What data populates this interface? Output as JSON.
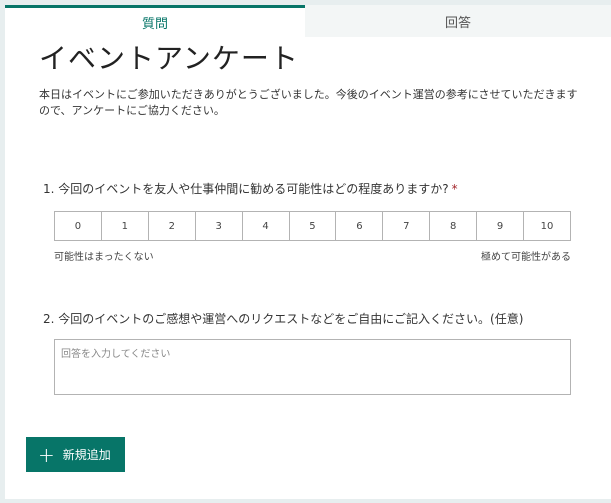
{
  "tabs": {
    "question_label": "質問",
    "answer_label": "回答"
  },
  "form": {
    "title": "イベントアンケート",
    "description": "本日はイベントにご参加いただきありがとうございました。今後のイベント運営の参考にさせていただきますので、アンケートにご協力ください。"
  },
  "question1": {
    "title": "1. 今回のイベントを友人や仕事仲間に勧める可能性はどの程度ありますか?",
    "required_mark": "*",
    "scale": [
      "0",
      "1",
      "2",
      "3",
      "4",
      "5",
      "6",
      "7",
      "8",
      "9",
      "10"
    ],
    "low_label": "可能性はまったくない",
    "high_label": "極めて可能性がある"
  },
  "question2": {
    "title": "2. 今回のイベントのご感想や運営へのリクエストなどをご自由にご記入ください。(任意)",
    "placeholder": "回答を入力してください"
  },
  "add_button": {
    "icon": "plus-icon",
    "label": "新規追加"
  },
  "colors": {
    "accent": "#077568",
    "background": "#e7eeef",
    "required": "#a4262c"
  }
}
